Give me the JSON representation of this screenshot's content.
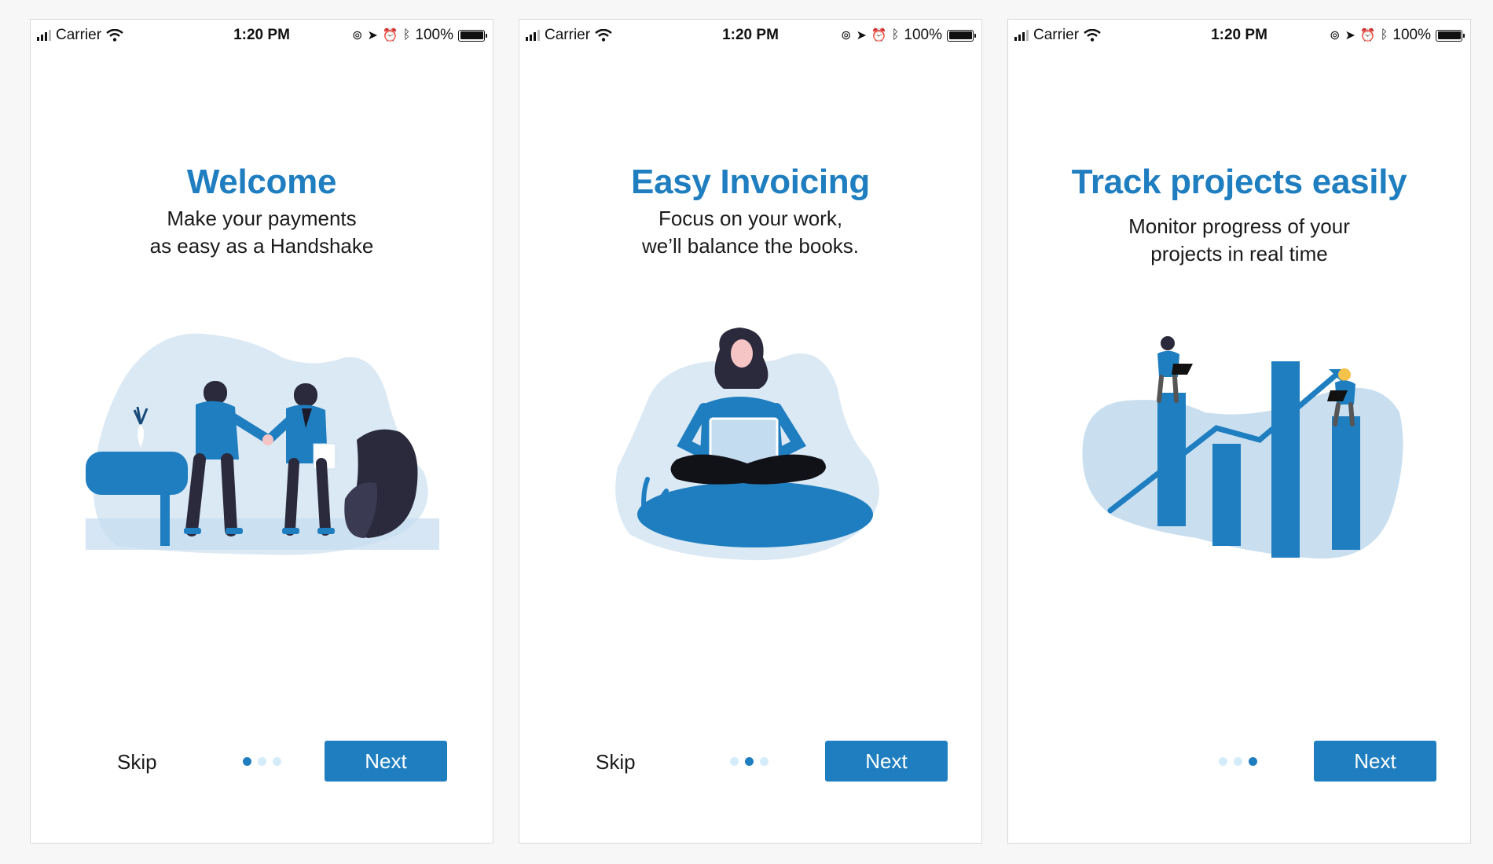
{
  "colors": {
    "accent": "#1f7ec0",
    "dot_inactive": "#d4ecf9",
    "illustration_light": "#dbe9f5",
    "illustration_dark": "#2a2a3c"
  },
  "screens": [
    {
      "status": {
        "carrier": "Carrier",
        "time": "1:20 PM",
        "battery": "100%"
      },
      "title": "Welcome",
      "subtitle_line1": "Make your payments",
      "subtitle_line2": "as easy as a Handshake",
      "skip_label": "Skip",
      "next_label": "Next",
      "page_indicator": {
        "current": 1,
        "total": 3
      },
      "illustration": "handshake-illustration"
    },
    {
      "status": {
        "carrier": "Carrier",
        "time": "1:20 PM",
        "battery": "100%"
      },
      "title": "Easy Invoicing",
      "subtitle_line1": "Focus on your work,",
      "subtitle_line2": "we’ll balance the books.",
      "skip_label": "Skip",
      "next_label": "Next",
      "page_indicator": {
        "current": 2,
        "total": 3
      },
      "illustration": "woman-with-laptop-illustration"
    },
    {
      "status": {
        "carrier": "Carrier",
        "time": "1:20 PM",
        "battery": "100%"
      },
      "title": "Track projects easily",
      "subtitle_line1": "Monitor progress of your",
      "subtitle_line2": "projects in real time",
      "next_label": "Next",
      "page_indicator": {
        "current": 3,
        "total": 3
      },
      "illustration": "bar-chart-people-illustration"
    }
  ]
}
